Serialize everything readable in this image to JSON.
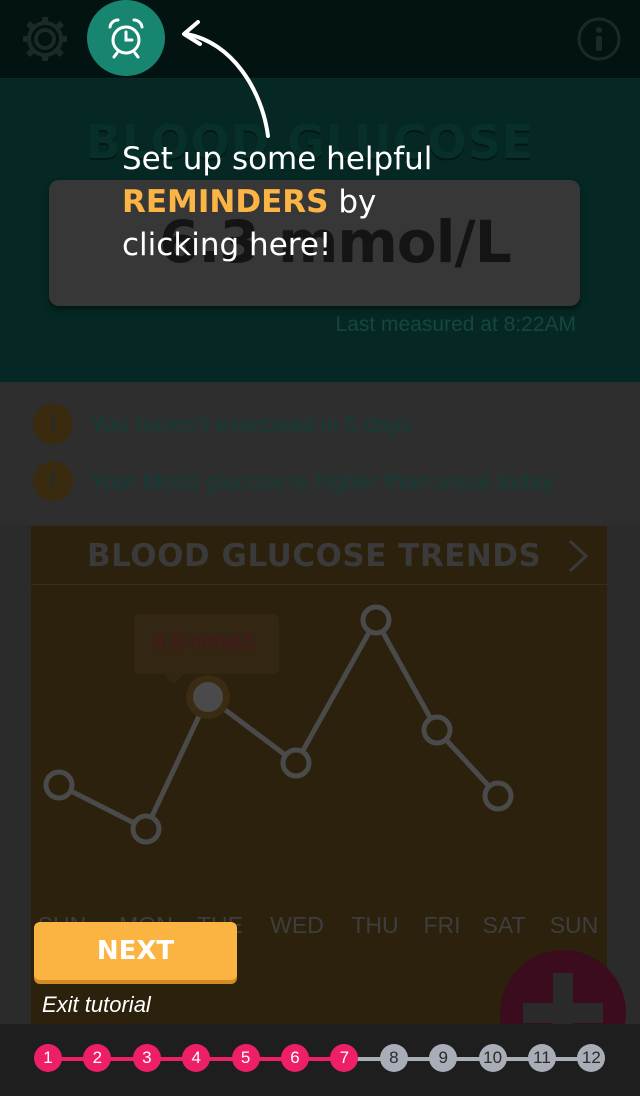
{
  "header": {
    "title": "BLOOD GLUCOSE",
    "reading": "6.3 mmol/L",
    "last_measured": "Last measured at 8:22AM"
  },
  "topbar": {
    "settings_icon": "gear-icon",
    "reminders_icon": "alarm-clock-icon",
    "info_icon": "info-icon"
  },
  "alerts": [
    {
      "icon": "!",
      "text": "You haven’t exercised in 5 days"
    },
    {
      "icon": "!",
      "text": "Your blood glucose is higher than usual today"
    }
  ],
  "trends": {
    "title": "BLOOD GLUCOSE TRENDS",
    "tooltip": "5.8 mmol/L",
    "days": [
      "SUN",
      "MON",
      "TUE",
      "WED",
      "THU",
      "FRI",
      "SAT",
      "SUN"
    ]
  },
  "chart_data": {
    "type": "line",
    "categories": [
      "SUN",
      "MON",
      "TUE",
      "WED",
      "THU",
      "FRI",
      "SAT"
    ],
    "values": [
      5.0,
      4.6,
      5.8,
      5.2,
      6.5,
      5.5,
      4.9
    ],
    "highlight_index": 2,
    "tooltip": "5.8 mmol/L"
  },
  "tutorial": {
    "tip_before": "Set up some helpful ",
    "tip_accent": "REMINDERS",
    "tip_after": " by clicking here!",
    "next_label": "NEXT",
    "exit_label": "Exit tutorial",
    "steps": [
      {
        "label": "1",
        "done": true
      },
      {
        "label": "2",
        "done": true
      },
      {
        "label": "3",
        "done": true
      },
      {
        "label": "4",
        "done": true
      },
      {
        "label": "5",
        "done": true
      },
      {
        "label": "6",
        "done": true
      },
      {
        "label": "7",
        "done": true
      },
      {
        "label": "8",
        "done": false
      },
      {
        "label": "9",
        "done": false
      },
      {
        "label": "10",
        "done": false
      },
      {
        "label": "11",
        "done": false
      },
      {
        "label": "12",
        "done": false
      }
    ]
  },
  "fab": {
    "icon": "plus-icon"
  },
  "colors": {
    "accent": "#fcb445",
    "teal": "#17856f",
    "step_done": "#ee1e69",
    "step_todo": "#a9adb7"
  }
}
